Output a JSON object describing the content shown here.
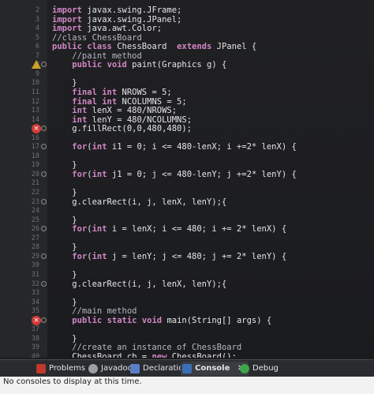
{
  "editor": {
    "lines": [
      {
        "n": "2",
        "code": "import javax.swing.JFrame;",
        "kw": "import",
        "gutter": ""
      },
      {
        "n": "3",
        "code": "import javax.swing.JPanel;",
        "kw": "import",
        "gutter": ""
      },
      {
        "n": "4",
        "code": "import java.awt.Color;",
        "kw": "import",
        "gutter": ""
      },
      {
        "n": "5",
        "code": "//class ChessBoard",
        "kw": "",
        "gutter": "",
        "comment": true
      },
      {
        "n": "6",
        "code": "public class ChessBoard  extends JPanel {",
        "kw": "",
        "gutter": ""
      },
      {
        "n": "7",
        "code": "    //paint method",
        "kw": "",
        "gutter": "",
        "comment": true
      },
      {
        "n": "8",
        "code": "    public void paint(Graphics g) {",
        "kw": "",
        "gutter": "warn"
      },
      {
        "n": "9",
        "code": "",
        "kw": "",
        "gutter": ""
      },
      {
        "n": "10",
        "code": "    }",
        "kw": "",
        "gutter": ""
      },
      {
        "n": "11",
        "code": "    final int NROWS = 5;",
        "kw": "",
        "gutter": ""
      },
      {
        "n": "12",
        "code": "    final int NCOLUMNS = 5;",
        "kw": "",
        "gutter": ""
      },
      {
        "n": "13",
        "code": "    int lenX = 480/NROWS;",
        "kw": "",
        "gutter": ""
      },
      {
        "n": "14",
        "code": "    int lenY = 480/NCOLUMNS;",
        "kw": "",
        "gutter": ""
      },
      {
        "n": "15",
        "code": "    g.fillRect(0,0,480,480);",
        "kw": "",
        "gutter": "err"
      },
      {
        "n": "16",
        "code": "",
        "kw": "",
        "gutter": ""
      },
      {
        "n": "17",
        "code": "    for(int i1 = 0; i <= 480-lenX; i +=2* lenX) {",
        "kw": "",
        "gutter": "mark"
      },
      {
        "n": "18",
        "code": "",
        "kw": "",
        "gutter": ""
      },
      {
        "n": "19",
        "code": "    }",
        "kw": "",
        "gutter": ""
      },
      {
        "n": "20",
        "code": "    for(int j1 = 0; j <= 480-lenY; j +=2* lenY) {",
        "kw": "",
        "gutter": "mark"
      },
      {
        "n": "21",
        "code": "",
        "kw": "",
        "gutter": ""
      },
      {
        "n": "22",
        "code": "    }",
        "kw": "",
        "gutter": ""
      },
      {
        "n": "23",
        "code": "    g.clearRect(i, j, lenX, lenY);{",
        "kw": "",
        "gutter": "mark"
      },
      {
        "n": "24",
        "code": "",
        "kw": "",
        "gutter": ""
      },
      {
        "n": "25",
        "code": "    }",
        "kw": "",
        "gutter": ""
      },
      {
        "n": "26",
        "code": "    for(int i = lenX; i <= 480; i += 2* lenX) {",
        "kw": "",
        "gutter": "mark"
      },
      {
        "n": "27",
        "code": "",
        "kw": "",
        "gutter": ""
      },
      {
        "n": "28",
        "code": "    }",
        "kw": "",
        "gutter": ""
      },
      {
        "n": "29",
        "code": "    for(int j = lenY; j <= 480; j += 2* lenY) {",
        "kw": "",
        "gutter": "mark"
      },
      {
        "n": "30",
        "code": "",
        "kw": "",
        "gutter": ""
      },
      {
        "n": "31",
        "code": "    }",
        "kw": "",
        "gutter": ""
      },
      {
        "n": "32",
        "code": "    g.clearRect(i, j, lenX, lenY);{",
        "kw": "",
        "gutter": "mark"
      },
      {
        "n": "33",
        "code": "",
        "kw": "",
        "gutter": ""
      },
      {
        "n": "34",
        "code": "    }",
        "kw": "",
        "gutter": ""
      },
      {
        "n": "35",
        "code": "    //main method",
        "kw": "",
        "gutter": "",
        "comment": true
      },
      {
        "n": "36",
        "code": "    public static void main(String[] args) {",
        "kw": "",
        "gutter": "err"
      },
      {
        "n": "37",
        "code": "",
        "kw": "",
        "gutter": ""
      },
      {
        "n": "38",
        "code": "    }",
        "kw": "",
        "gutter": ""
      },
      {
        "n": "39",
        "code": "    //create an instance of ChessBoard",
        "kw": "",
        "gutter": "",
        "comment": true
      },
      {
        "n": "40",
        "code": "    ChessBoard cb = new ChessBoard();",
        "kw": "",
        "gutter": ""
      }
    ]
  },
  "panel": {
    "tabs": [
      {
        "label": "Problems",
        "icon_color": "#c0392b"
      },
      {
        "label": "Javadoc",
        "icon_color": "#9aa0a6"
      },
      {
        "label": "Declaration",
        "icon_color": "#5b7fc7"
      },
      {
        "label": "Console",
        "icon_color": "#3b6fb6",
        "active": true
      },
      {
        "label": "Debug",
        "icon_color": "#3fa34d"
      }
    ],
    "close_glyph": "✕",
    "message": "No consoles to display at this time."
  },
  "colors": {
    "keyword": "#d287c6",
    "error": "#d13a36",
    "warning": "#c9a227"
  }
}
